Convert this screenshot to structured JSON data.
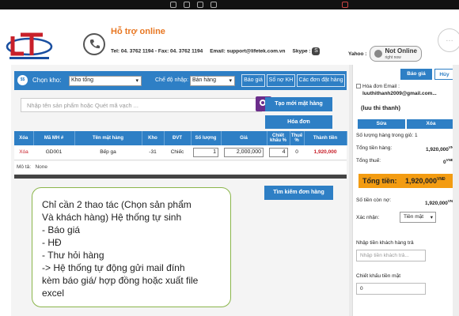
{
  "header": {
    "support_title": "Hỗ trợ online",
    "tel_fax": "Tel: 04. 3762 1194 - Fax: 04. 3762 1194",
    "email": "Email: support@lifetek.com.vn",
    "skype_label": "Skype :",
    "yahoo_label": "Yahoo :",
    "status_main": "Not Online",
    "status_sub": "right now",
    "colors": {
      "accent_orange": "#e87722",
      "primary_blue": "#2e7fc5"
    }
  },
  "toolbar": {
    "warehouse_label": "Chọn kho:",
    "warehouse_value": "Kho tổng",
    "mode_label": "Chế độ nhập:",
    "mode_value": "Bán hàng",
    "btn_quote": "Báo giá",
    "btn_debt": "Số nợ KH",
    "btn_orders": "Các đơn đặt hàng"
  },
  "search": {
    "placeholder": "Nhập tên sản phẩm hoặc Quét mã vạch ...",
    "btn_new_order": "Tạo mới mặt hàng",
    "btn_invoice": "Hóa đơn",
    "btn_find_order": "Tìm kiếm đơn hàng"
  },
  "table": {
    "headers": [
      "Xóa",
      "Mã MH #",
      "Tên mặt hàng",
      "Kho",
      "ĐVT",
      "Số lượng",
      "Giá",
      "Chiết khấu %",
      "Thuế %",
      "Thành tiền"
    ],
    "rows": [
      {
        "delete": "Xóa",
        "code": "GD001",
        "name": "Bếp ga",
        "stock": "-31",
        "unit": "Chiếc",
        "qty": "1",
        "price": "2,000,000",
        "discount": "4",
        "tax": "0",
        "total": "1,920,000"
      }
    ],
    "desc_label": "Mô tả:",
    "desc_value": "None"
  },
  "callout": {
    "lines": [
      "Chỉ cần 2 thao tác (Chọn sản phẩm",
      "Và khách hàng) Hệ thống tự sinh",
      "-    Báo giá",
      "-    HĐ",
      "-    Thư hỏi hàng",
      "-> Hệ thống tự động gửi mail đính",
      "kèm báo giá/ hợp đồng hoặc xuất file",
      "excel"
    ]
  },
  "right": {
    "btn_quote": "Báo giá",
    "btn_cancel": "Hủy",
    "invoice_email_label": "Hóa đơn Email :",
    "email_value": "luuthithanh2009@gmail.com...",
    "customer_name": "(luu thi thanh)",
    "btn_edit": "Sửa",
    "btn_delete": "Xóa",
    "items_count_label": "Số lượng hàng trong giỏ: 1",
    "subtotal_label": "Tổng tiền hàng:",
    "subtotal_value": "1,920,000",
    "tax_label": "Tổng thuế:",
    "tax_value": "0",
    "currency": "VNĐ",
    "total_label": "Tổng tiền:",
    "total_value": "1,920,000",
    "debt_label": "Số tiền còn nợ:",
    "debt_value": "1,920,000",
    "confirm_label": "Xác nhận:",
    "confirm_value": "Tiền mặt",
    "customer_pay_label": "Nhập tiền khách hàng trả",
    "customer_pay_placeholder": "Nhập tiền khách trả...",
    "cash_discount_label": "Chiết khấu tiền mặt",
    "cash_discount_value": "0"
  }
}
